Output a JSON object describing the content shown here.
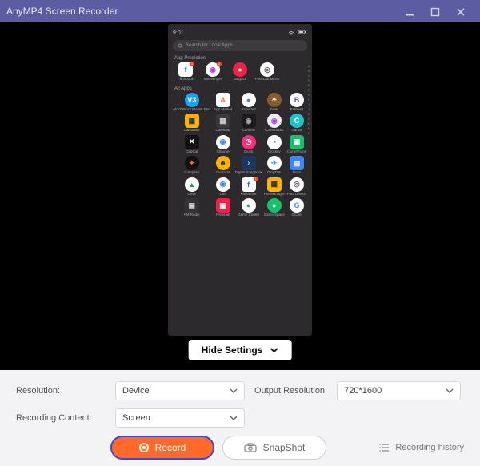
{
  "titlebar": {
    "title": "AnyMP4 Screen Recorder"
  },
  "phone": {
    "time": "9:01",
    "search_placeholder": "Search for Local Apps",
    "prediction_label": "App Prediction",
    "all_apps_label": "All Apps",
    "alpha_index": [
      "A",
      "B",
      "C",
      "D",
      "E",
      "F",
      "G",
      "H",
      "I",
      "J",
      "K",
      "L",
      "M",
      "N",
      "O"
    ]
  },
  "apps_prediction": [
    {
      "name": "Facebook",
      "glyph": "f",
      "bg": "#fff",
      "fg": "#1877f2",
      "sq": true,
      "badge": "1"
    },
    {
      "name": "Messenger",
      "glyph": "◉",
      "bg": "#fff",
      "fg": "#b339e8",
      "badge": "2"
    },
    {
      "name": "BingoLk",
      "glyph": "●",
      "bg": "#e24",
      "fg": "#fff"
    },
    {
      "name": "FoneLab Mirror",
      "glyph": "◎",
      "bg": "#fff",
      "fg": "#555"
    }
  ],
  "apps_all": [
    {
      "name": "AfroTalk V3 Mobile Plus",
      "glyph": "V3",
      "bg": "#1da1f2",
      "fg": "#fff"
    },
    {
      "name": "App Market",
      "glyph": "A",
      "bg": "#fff",
      "fg": "#ff6a2b",
      "sq": true
    },
    {
      "name": "Assistant",
      "glyph": "●",
      "bg": "#fff",
      "fg": "#4285f4"
    },
    {
      "name": "bible",
      "glyph": "✶",
      "bg": "#8b5a2b",
      "fg": "#fff"
    },
    {
      "name": "BitNews",
      "glyph": "B",
      "bg": "#fff",
      "fg": "#6a4caf"
    },
    {
      "name": "Calculator",
      "glyph": "▦",
      "bg": "#ffb300",
      "fg": "#333",
      "sq": true
    },
    {
      "name": "Calendar",
      "glyph": "▦",
      "bg": "#3a3a3a",
      "fg": "#ccc",
      "sq": true
    },
    {
      "name": "Camera",
      "glyph": "◉",
      "bg": "#1a1a1a",
      "fg": "#aaa",
      "sq": true
    },
    {
      "name": "Camera360",
      "glyph": "◉",
      "bg": "#eee",
      "fg": "#b339e8"
    },
    {
      "name": "Canva",
      "glyph": "C",
      "bg": "#20c4cb",
      "fg": "#fff"
    },
    {
      "name": "CapCut",
      "glyph": "✕",
      "bg": "#111",
      "fg": "#fff",
      "sq": true
    },
    {
      "name": "Chrome",
      "glyph": "◉",
      "bg": "#fff",
      "fg": "#4285f4"
    },
    {
      "name": "Clock",
      "glyph": "◷",
      "bg": "#ff2d7a",
      "fg": "#fff"
    },
    {
      "name": "Clockify",
      "glyph": "◔",
      "bg": "#fff",
      "fg": "#03a9f4"
    },
    {
      "name": "ClonePhone",
      "glyph": "▣",
      "bg": "#15c26b",
      "fg": "#fff",
      "sq": true
    },
    {
      "name": "Compass",
      "glyph": "✦",
      "bg": "#111",
      "fg": "#ff6a2b"
    },
    {
      "name": "Contacts",
      "glyph": "☻",
      "bg": "#ffb300",
      "fg": "#333"
    },
    {
      "name": "Digital Songbook",
      "glyph": "♪",
      "bg": "#19375f",
      "fg": "#fff",
      "sq": true
    },
    {
      "name": "DingTalk",
      "glyph": "✈",
      "bg": "#fff",
      "fg": "#3296fa"
    },
    {
      "name": "Docs",
      "glyph": "▤",
      "bg": "#4285f4",
      "fg": "#fff",
      "sq": true
    },
    {
      "name": "Drive",
      "glyph": "▲",
      "bg": "#fff",
      "fg": "#0f9d58"
    },
    {
      "name": "Duo",
      "glyph": "◉",
      "bg": "#fff",
      "fg": "#4285f4"
    },
    {
      "name": "Facebook",
      "glyph": "f",
      "bg": "#fff",
      "fg": "#1877f2",
      "sq": true,
      "badge": "1"
    },
    {
      "name": "File Manager",
      "glyph": "▦",
      "bg": "#ffb300",
      "fg": "#333",
      "sq": true
    },
    {
      "name": "Find Device",
      "glyph": "◎",
      "bg": "#fff",
      "fg": "#555"
    },
    {
      "name": "FM Radio",
      "glyph": "▣",
      "bg": "#333",
      "fg": "#ccc",
      "sq": true
    },
    {
      "name": "FoneLab",
      "glyph": "▣",
      "bg": "#e24",
      "fg": "#fff",
      "sq": true
    },
    {
      "name": "Game Center",
      "glyph": "●",
      "bg": "#fff",
      "fg": "#15c26b"
    },
    {
      "name": "Game Space",
      "glyph": "●",
      "bg": "#15c26b",
      "fg": "#fff"
    },
    {
      "name": "GCam",
      "glyph": "G",
      "bg": "#fff",
      "fg": "#4285f4"
    }
  ],
  "hide_settings_label": "Hide Settings",
  "settings": {
    "resolution_label": "Resolution:",
    "resolution_value": "Device",
    "output_label": "Output Resolution:",
    "output_value": "720*1600",
    "content_label": "Recording Content:",
    "content_value": "Screen"
  },
  "buttons": {
    "record": "Record",
    "snapshot": "SnapShot",
    "history": "Recording history"
  }
}
